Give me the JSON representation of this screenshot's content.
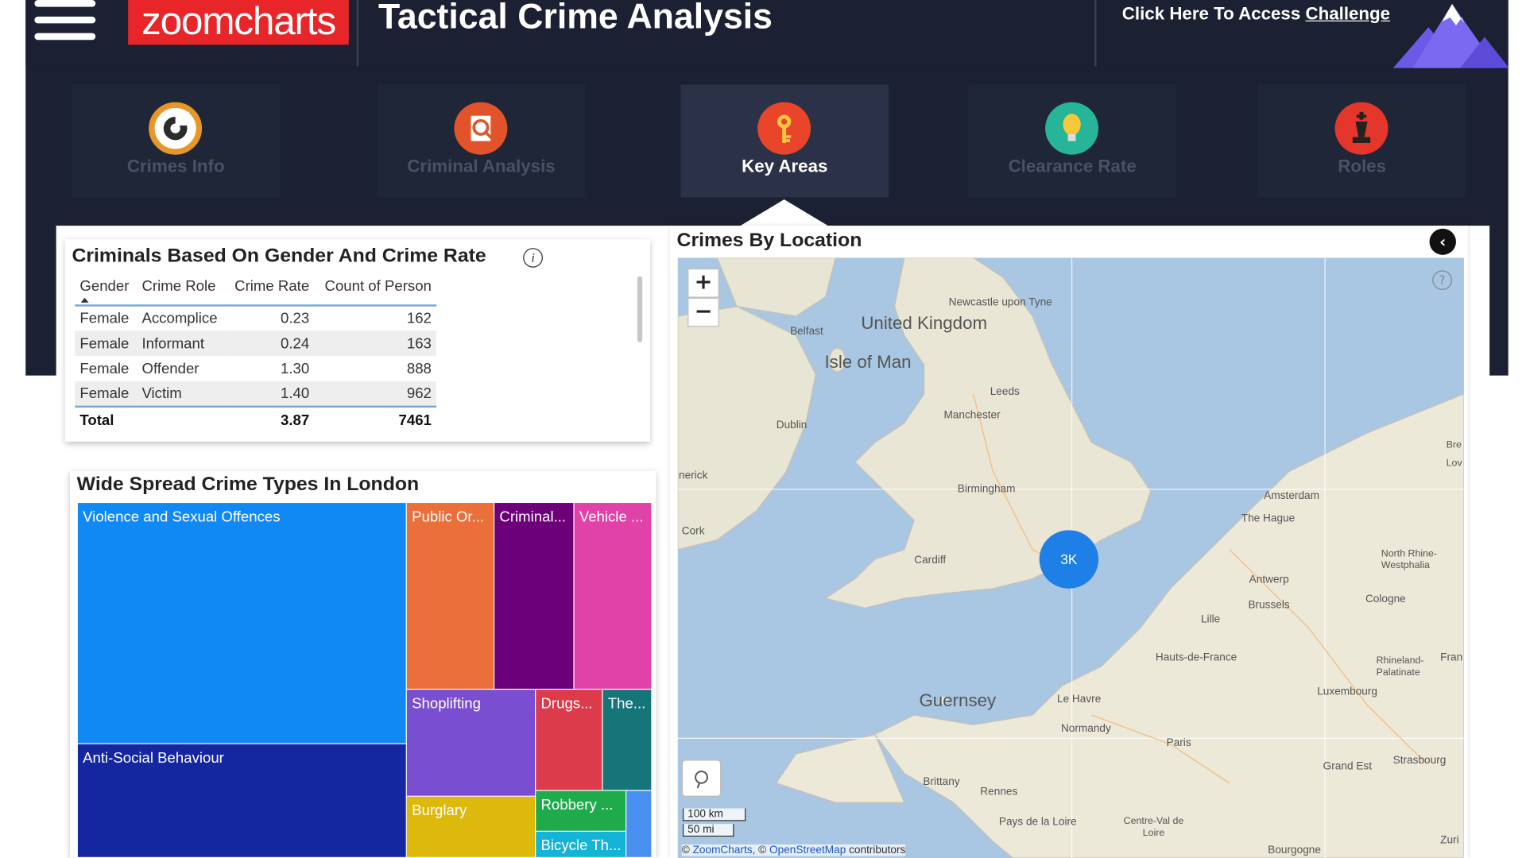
{
  "header": {
    "logo": "zoomcharts",
    "title": "Tactical Crime Analysis",
    "challenge_prefix": "Click Here To Access",
    "challenge_link": "Challenge"
  },
  "tabs": [
    {
      "label": "Crimes Info",
      "icon": "target-icon",
      "color": "#e8962a"
    },
    {
      "label": "Criminal Analysis",
      "icon": "magnifier-icon",
      "color": "#e2532a"
    },
    {
      "label": "Key Areas",
      "icon": "key-icon",
      "color": "#e8452a",
      "active": true
    },
    {
      "label": "Clearance Rate",
      "icon": "lightbulb-icon",
      "color": "#27b59a"
    },
    {
      "label": "Roles",
      "icon": "chess-icon",
      "color": "#e4362a"
    }
  ],
  "gender_table": {
    "title": "Criminals Based On Gender And Crime Rate",
    "info": "i",
    "columns": [
      "Gender",
      "Crime Role",
      "Crime Rate",
      "Count of Person"
    ],
    "rows": [
      [
        "Female",
        "Accomplice",
        "0.23",
        "162"
      ],
      [
        "Female",
        "Informant",
        "0.24",
        "163"
      ],
      [
        "Female",
        "Offender",
        "1.30",
        "888"
      ],
      [
        "Female",
        "Victim",
        "1.40",
        "962"
      ]
    ],
    "total": {
      "label": "Total",
      "rate": "3.87",
      "count": "7461"
    }
  },
  "treemap": {
    "title": "Wide Spread Crime Types In London",
    "cells": [
      {
        "label": "Violence and Sexual Offences",
        "color": "#1189f5"
      },
      {
        "label": "Anti-Social Behaviour",
        "color": "#1427a0"
      },
      {
        "label": "Public Or...",
        "color": "#ea6f3a"
      },
      {
        "label": "Criminal...",
        "color": "#6b0079"
      },
      {
        "label": "Vehicle ...",
        "color": "#e042a8"
      },
      {
        "label": "Shoplifting",
        "color": "#7a4ed0"
      },
      {
        "label": "Drugs...",
        "color": "#dc3b4b"
      },
      {
        "label": "The...",
        "color": "#167579"
      },
      {
        "label": "Burglary",
        "color": "#dcb90a"
      },
      {
        "label": "Robbery ...",
        "color": "#1fab4c"
      },
      {
        "label": "Bicycle Th...",
        "color": "#14b4d8"
      },
      {
        "label": "",
        "color": "#4a90f0"
      }
    ]
  },
  "map": {
    "title": "Crimes By Location",
    "back": "‹",
    "zoom_in": "+",
    "zoom_out": "−",
    "help": "?",
    "cluster_label": "3K",
    "scale_km": "100 km",
    "scale_mi": "50 mi",
    "attribution": {
      "prefix": "©",
      "zc": "ZoomCharts",
      "sep": ", ©",
      "osm": "OpenStreetMap",
      "suffix": "contributors"
    },
    "places": [
      "Newcastle upon Tyne",
      "United Kingdom",
      "Belfast",
      "Isle of Man",
      "Leeds",
      "Manchester",
      "Dublin",
      "Birmingham",
      "nerick",
      "Cork",
      "Cardiff",
      "Amsterdam",
      "The Hague",
      "Antwerp",
      "Brussels",
      "North Rhine-Westphalia",
      "Cologne",
      "Lille",
      "Hauts-de-France",
      "Rhineland-Palatinate",
      "Luxembourg",
      "Guernsey",
      "Le Havre",
      "Normandy",
      "Paris",
      "Grand Est",
      "Strasbourg",
      "Brittany",
      "Rennes",
      "Pays de la Loire",
      "Centre-Val de Loire",
      "Bourgogne",
      "Bre",
      "Lov",
      "Fran",
      "Zuri"
    ]
  }
}
